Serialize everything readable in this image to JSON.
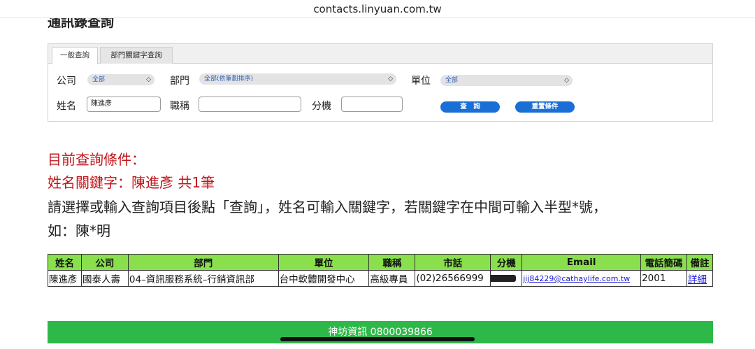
{
  "browser": {
    "url": "contacts.linyuan.com.tw"
  },
  "page": {
    "title": "通訊錄查詢"
  },
  "tabs": [
    "一般查詢",
    "部門關鍵字查詢"
  ],
  "form": {
    "company_label": "公司",
    "company_value": "全部",
    "department_label": "部門",
    "department_value": "全部(依筆劃排序)",
    "unit_label": "單位",
    "unit_value": "全部",
    "name_label": "姓名",
    "name_value": "陳進彥",
    "title_label": "職稱",
    "title_value": "",
    "ext_label": "分機",
    "ext_value": "",
    "search_button": "查　詢",
    "reset_button": "重置條件"
  },
  "conditions": {
    "heading": "目前查詢條件：",
    "keyword_line": "姓名關鍵字：陳進彥 共1筆",
    "instruction_line1": "請選擇或輸入查詢項目後點「查詢」，姓名可輸入關鍵字，若關鍵字在中間可輸入半型*號，",
    "instruction_line2": "如：陳*明"
  },
  "table": {
    "headers": [
      "姓名",
      "公司",
      "部門",
      "單位",
      "職稱",
      "市話",
      "分機",
      "Email",
      "電話簡碼",
      "備註"
    ],
    "rows": [
      {
        "name": "陳進彥",
        "company": "國泰人壽",
        "department": "04–資訊服務系統–行銷資訊部",
        "unit": "台中軟體開發中心",
        "title": "高級專員",
        "phone": "(02)26566999",
        "ext": "",
        "email": "jij84229@cathaylife.com.tw",
        "short_code": "2001",
        "note": "詳細"
      }
    ]
  },
  "footer": {
    "text": "神坊資訊 0800039866"
  },
  "colors": {
    "accent_button": "#1a6fd6",
    "table_header": "#89e04c",
    "footer": "#2fb84a",
    "condition_text": "#c0161b"
  }
}
